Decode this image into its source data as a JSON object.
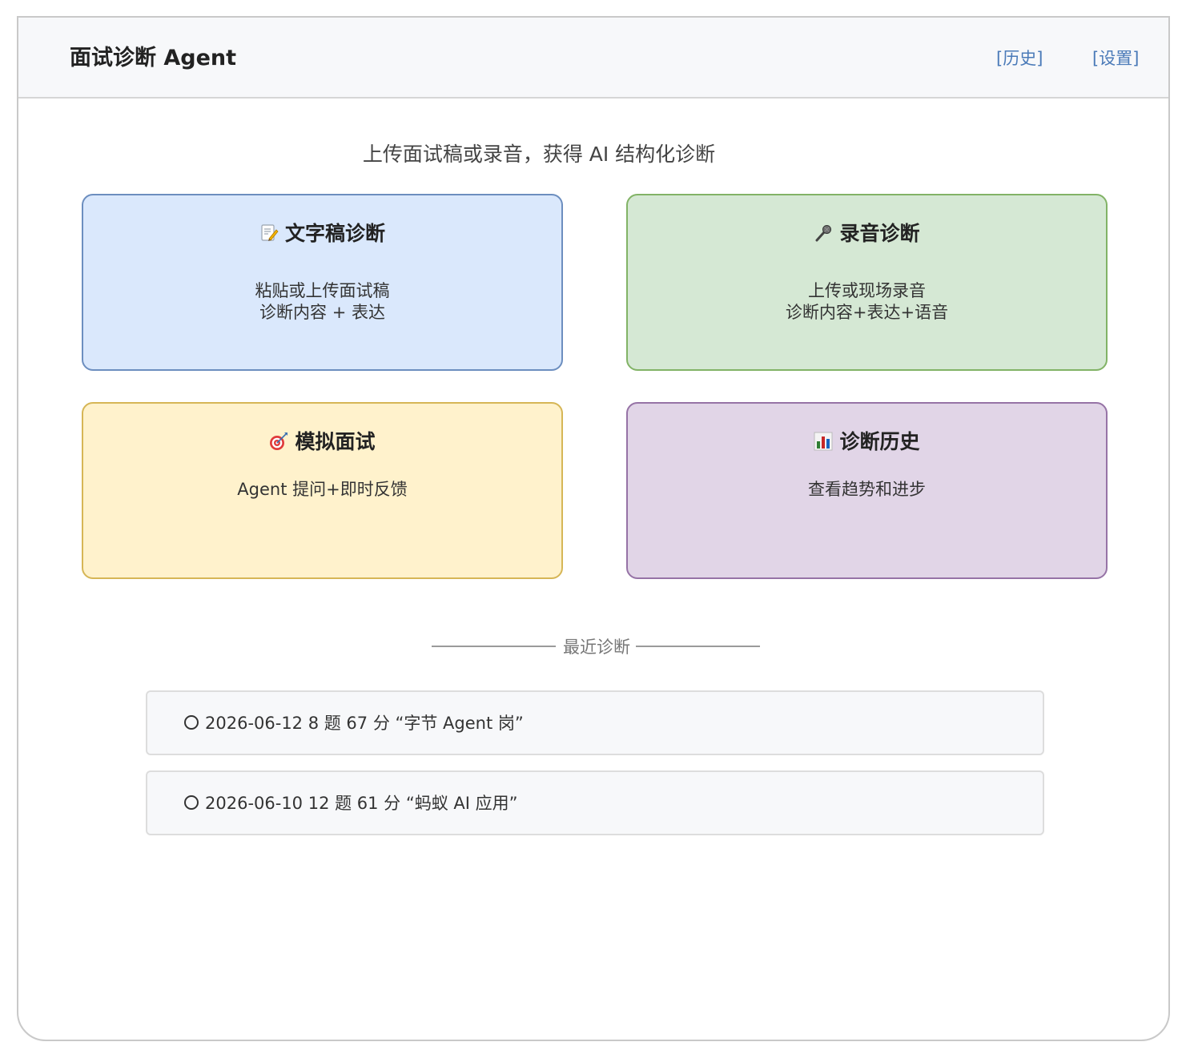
{
  "header": {
    "title": "面试诊断 Agent",
    "nav": {
      "history": "[历史]",
      "settings": "[设置]"
    }
  },
  "subtitle": "上传面试稿或录音，获得 AI 结构化诊断",
  "cards": {
    "text": {
      "icon": "memo-icon",
      "title": "文字稿诊断",
      "lines": [
        "粘贴或上传面试稿",
        "诊断内容 + 表达"
      ]
    },
    "audio": {
      "icon": "microphone-icon",
      "title": "录音诊断",
      "lines": [
        "上传或现场录音",
        "诊断内容+表达+语音"
      ]
    },
    "mock": {
      "icon": "target-icon",
      "title": "模拟面试",
      "lines": [
        "Agent 提问+即时反馈"
      ]
    },
    "history": {
      "icon": "bar-chart-icon",
      "title": "诊断历史",
      "lines": [
        "查看趋势和进步"
      ]
    }
  },
  "recent": {
    "label": "最近诊断",
    "items": [
      {
        "text": "2026-06-12 8 题 67 分 “字节 Agent 岗”"
      },
      {
        "text": "2026-06-10 12 题 61 分 “蚂蚁 AI 应用”"
      }
    ]
  },
  "colors": {
    "text_card_bg": "#dae8fc",
    "audio_card_bg": "#d5e8d4",
    "mock_card_bg": "#fff2cc",
    "history_card_bg": "#e1d5e7",
    "link": "#4a7ab8"
  }
}
